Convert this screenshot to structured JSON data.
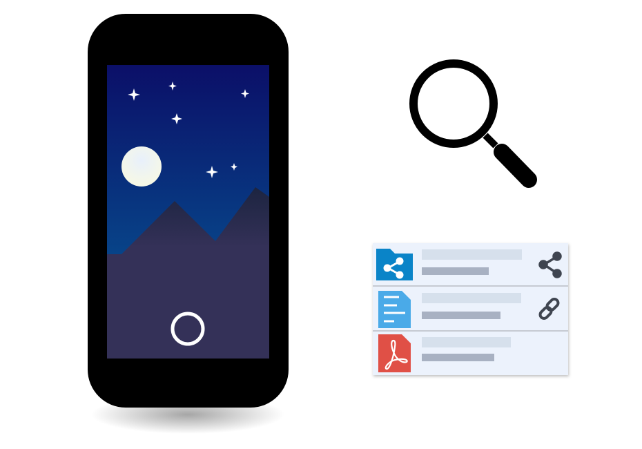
{
  "colors": {
    "phone_body": "#000000",
    "sky_top": "#0b0f68",
    "sky_bottom": "#05609a",
    "mountain": "#343158",
    "moon": "#eef4f4",
    "card_background": "#ecf2fc",
    "placeholder_light": "#d6e0ec",
    "placeholder_dark": "#a8b1c2",
    "shared_folder": "#0a84c8",
    "document": "#4aaae8",
    "pdf": "#e05046",
    "action_icon": "#3f4550"
  },
  "file_list": [
    {
      "icon": "shared-folder-icon",
      "action_icon": "share-icon"
    },
    {
      "icon": "document-icon",
      "action_icon": "link-icon"
    },
    {
      "icon": "pdf-icon",
      "action_icon": ""
    }
  ],
  "icons": [
    "magnifying-glass-icon",
    "moon-icon",
    "star-icon",
    "camera-shutter-button"
  ]
}
